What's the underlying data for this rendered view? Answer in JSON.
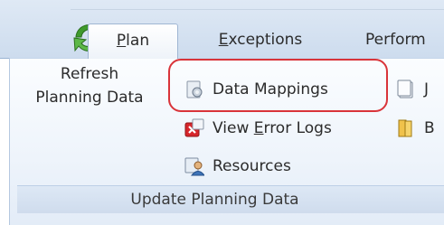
{
  "tabs": [
    {
      "id": "plan",
      "label_pre": "",
      "label_mn": "P",
      "label_post": "lan",
      "active": true
    },
    {
      "id": "exceptions",
      "label_pre": "",
      "label_mn": "E",
      "label_post": "xceptions",
      "active": false
    },
    {
      "id": "performance",
      "label": "Perform",
      "active": false
    }
  ],
  "ribbon": {
    "group_label": "Update Planning Data",
    "refresh": {
      "line1": "Refresh",
      "line2": "Planning Data",
      "icon": "refresh-icon"
    },
    "data_mappings": {
      "label": "Data Mappings",
      "icon": "data-mappings-icon"
    },
    "view_error_logs": {
      "label_pre": "View ",
      "label_mn": "E",
      "label_post": "rror Logs",
      "icon": "error-logs-icon"
    },
    "resources": {
      "label": "Resources",
      "icon": "resources-icon"
    },
    "truncated_1": {
      "label": "J"
    },
    "truncated_2": {
      "label": "B"
    }
  },
  "colors": {
    "highlight": "#d9343a",
    "refresh_green": "#3f9a2c",
    "error_red": "#d6262b",
    "tab_border": "#9fb6d3"
  }
}
